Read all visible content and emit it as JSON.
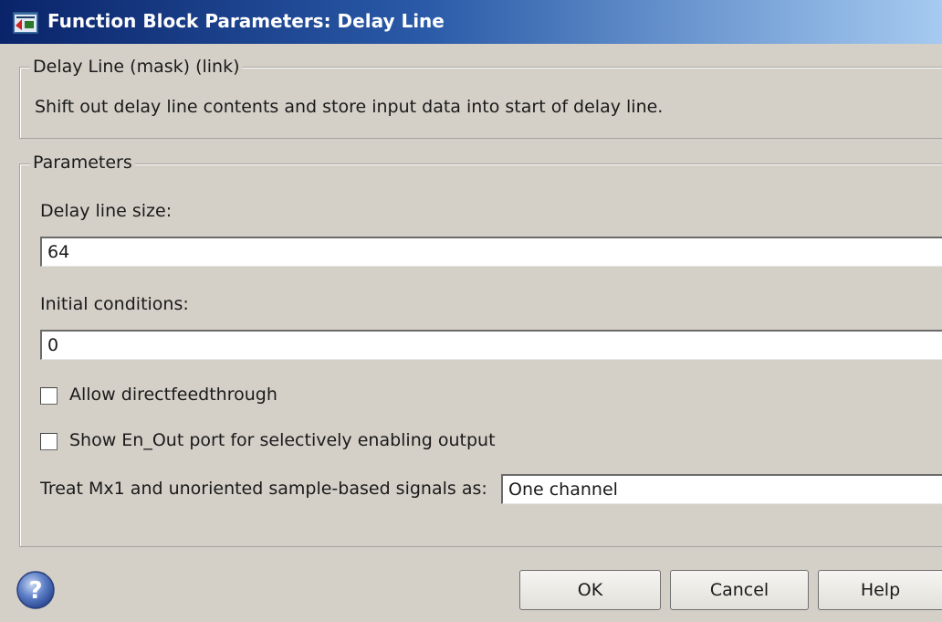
{
  "window": {
    "title": "Function Block Parameters: Delay Line"
  },
  "mask_group": {
    "legend": "Delay Line (mask) (link)",
    "description": "Shift out delay line contents and store input data into start of delay line."
  },
  "parameters": {
    "legend": "Parameters",
    "delay_line_size_label": "Delay line size:",
    "delay_line_size_value": "64",
    "initial_conditions_label": "Initial conditions:",
    "initial_conditions_value": "0",
    "allow_direct_feedthrough_label": "Allow directfeedthrough",
    "allow_direct_feedthrough_checked": false,
    "show_en_out_label": "Show En_Out port for selectively enabling output",
    "show_en_out_checked": false,
    "treat_signals_label": "Treat Mx1 and unoriented sample-based signals as:",
    "treat_signals_value": "One channel"
  },
  "buttons": {
    "ok": "OK",
    "cancel": "Cancel",
    "help": "Help"
  },
  "icons": {
    "title": "simulink-block-icon",
    "help": "question-mark-icon"
  },
  "colors": {
    "window_background": "#d4d0c8",
    "titlebar_start": "#0a246a",
    "titlebar_end": "#a6caf0"
  }
}
